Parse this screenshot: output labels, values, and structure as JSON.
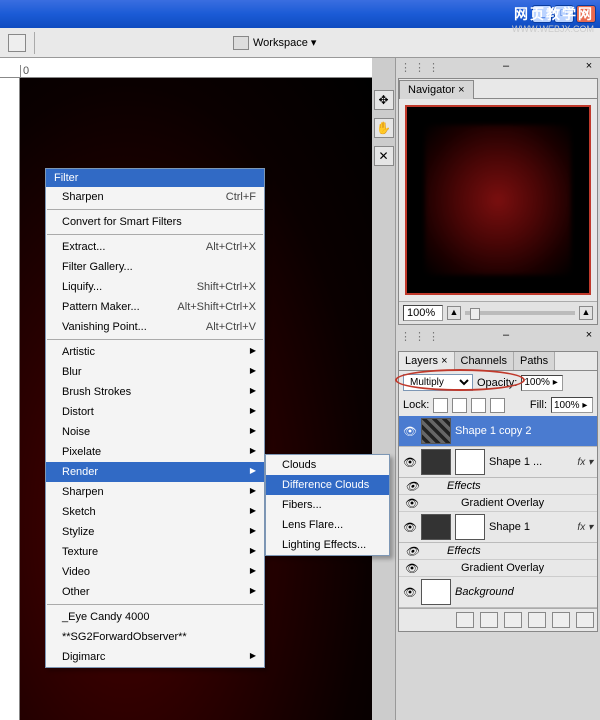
{
  "watermark": {
    "main": "网页教学网",
    "url": "WWW.WEBJX.COM"
  },
  "toolbar": {
    "workspace": "Workspace ▾"
  },
  "filter_menu": {
    "title": "Filter",
    "sharpen": {
      "label": "Sharpen",
      "shortcut": "Ctrl+F"
    },
    "convert": "Convert for Smart Filters",
    "extract": {
      "label": "Extract...",
      "shortcut": "Alt+Ctrl+X"
    },
    "gallery": "Filter Gallery...",
    "liquify": {
      "label": "Liquify...",
      "shortcut": "Shift+Ctrl+X"
    },
    "pattern": {
      "label": "Pattern Maker...",
      "shortcut": "Alt+Shift+Ctrl+X"
    },
    "vanish": {
      "label": "Vanishing Point...",
      "shortcut": "Alt+Ctrl+V"
    },
    "groups": [
      "Artistic",
      "Blur",
      "Brush Strokes",
      "Distort",
      "Noise",
      "Pixelate",
      "Render",
      "Sharpen",
      "Sketch",
      "Stylize",
      "Texture",
      "Video",
      "Other"
    ],
    "plugins": [
      "_Eye Candy 4000",
      "**SG2ForwardObserver**",
      "Digimarc"
    ]
  },
  "render_submenu": [
    "Clouds",
    "Difference Clouds",
    "Fibers...",
    "Lens Flare...",
    "Lighting Effects..."
  ],
  "navigator": {
    "tab": "Navigator ×",
    "zoom": "100%"
  },
  "layers": {
    "tabs": [
      "Layers ×",
      "Channels",
      "Paths"
    ],
    "blend": "Multiply",
    "opacity_label": "Opacity:",
    "opacity_val": "100% ▸",
    "lock_label": "Lock:",
    "fill_label": "Fill:",
    "fill_val": "100% ▸",
    "rows": [
      {
        "name": "Shape 1 copy 2",
        "selected": true,
        "mask": false,
        "thumb": "cloud"
      },
      {
        "name": "Shape 1 ...",
        "selected": false,
        "mask": true,
        "fx": true,
        "thumb": "black"
      },
      {
        "name": "Shape 1",
        "selected": false,
        "mask": true,
        "fx": true,
        "thumb": "black"
      },
      {
        "name": "Background",
        "selected": false,
        "mask": false,
        "thumb": "white"
      }
    ],
    "effects": "Effects",
    "grad": "Gradient Overlay"
  }
}
